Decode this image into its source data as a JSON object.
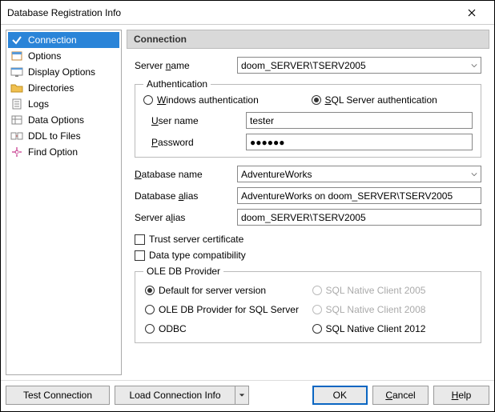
{
  "window": {
    "title": "Database Registration Info"
  },
  "sidebar": {
    "items": [
      {
        "label": "Connection"
      },
      {
        "label": "Options"
      },
      {
        "label": "Display Options"
      },
      {
        "label": "Directories"
      },
      {
        "label": "Logs"
      },
      {
        "label": "Data Options"
      },
      {
        "label": "DDL to Files"
      },
      {
        "label": "Find Option"
      }
    ]
  },
  "main": {
    "header": "Connection",
    "server_name_label": "Server name",
    "server_name_value": "doom_SERVER\\TSERV2005",
    "auth": {
      "legend": "Authentication",
      "windows_label": "Windows authentication",
      "sql_label": "SQL Server authentication",
      "user_label": "User name",
      "user_value": "tester",
      "password_label": "Password",
      "password_value": "●●●●●●"
    },
    "db_name_label": "Database name",
    "db_name_value": "AdventureWorks",
    "db_alias_label": "Database alias",
    "db_alias_value": "AdventureWorks on doom_SERVER\\TSERV2005",
    "server_alias_label": "Server alias",
    "server_alias_value": "doom_SERVER\\TSERV2005",
    "trust_cert_label": "Trust server certificate",
    "compat_label": "Data type compatibility",
    "provider": {
      "legend": "OLE DB Provider",
      "opt_default": "Default for server version",
      "opt_oledb": "OLE DB Provider for SQL Server",
      "opt_odbc": "ODBC",
      "opt_2005": "SQL Native Client 2005",
      "opt_2008": "SQL Native Client 2008",
      "opt_2012": "SQL Native Client 2012"
    }
  },
  "footer": {
    "test": "Test Connection",
    "load": "Load Connection Info",
    "ok": "OK",
    "cancel": "Cancel",
    "help": "Help"
  }
}
